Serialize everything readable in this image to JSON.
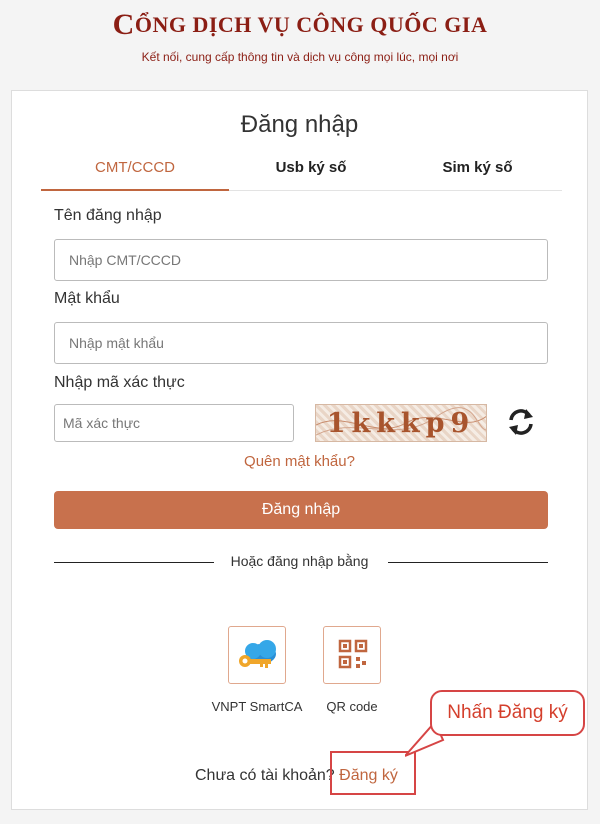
{
  "header": {
    "logo_glyph": "C",
    "title": "ỔNG DỊCH VỤ CÔNG QUỐC GIA",
    "tagline": "Kết nối, cung cấp thông tin và dịch vụ công mọi lúc, mọi nơi"
  },
  "login": {
    "title": "Đăng nhập",
    "tabs": [
      {
        "label": "CMT/CCCD",
        "active": true
      },
      {
        "label": "Usb ký số",
        "active": false
      },
      {
        "label": "Sim ký số",
        "active": false
      }
    ],
    "username_label": "Tên đăng nhập",
    "username_placeholder": "Nhập CMT/CCCD",
    "password_label": "Mật khẩu",
    "password_placeholder": "Nhập mật khẩu",
    "captcha_label": "Nhập mã xác thực",
    "captcha_placeholder": "Mã xác thực",
    "captcha_text": "1kkkp9",
    "forgot_label": "Quên mật khẩu?",
    "submit_label": "Đăng nhập",
    "or_label": "Hoặc đăng nhập bằng",
    "alt_methods": [
      {
        "label": "VNPT SmartCA",
        "icon": "vnpt-smartca-icon"
      },
      {
        "label": "QR code",
        "icon": "qr-code-icon"
      }
    ],
    "no_account_text": "Chưa có tài khoản?",
    "register_label": "Đăng ký"
  },
  "annotation": {
    "callout_text": "Nhấn Đăng ký"
  },
  "colors": {
    "accent": "#c0663f",
    "button": "#c8714d",
    "brand": "#8b1e14",
    "callout": "#d64545"
  }
}
